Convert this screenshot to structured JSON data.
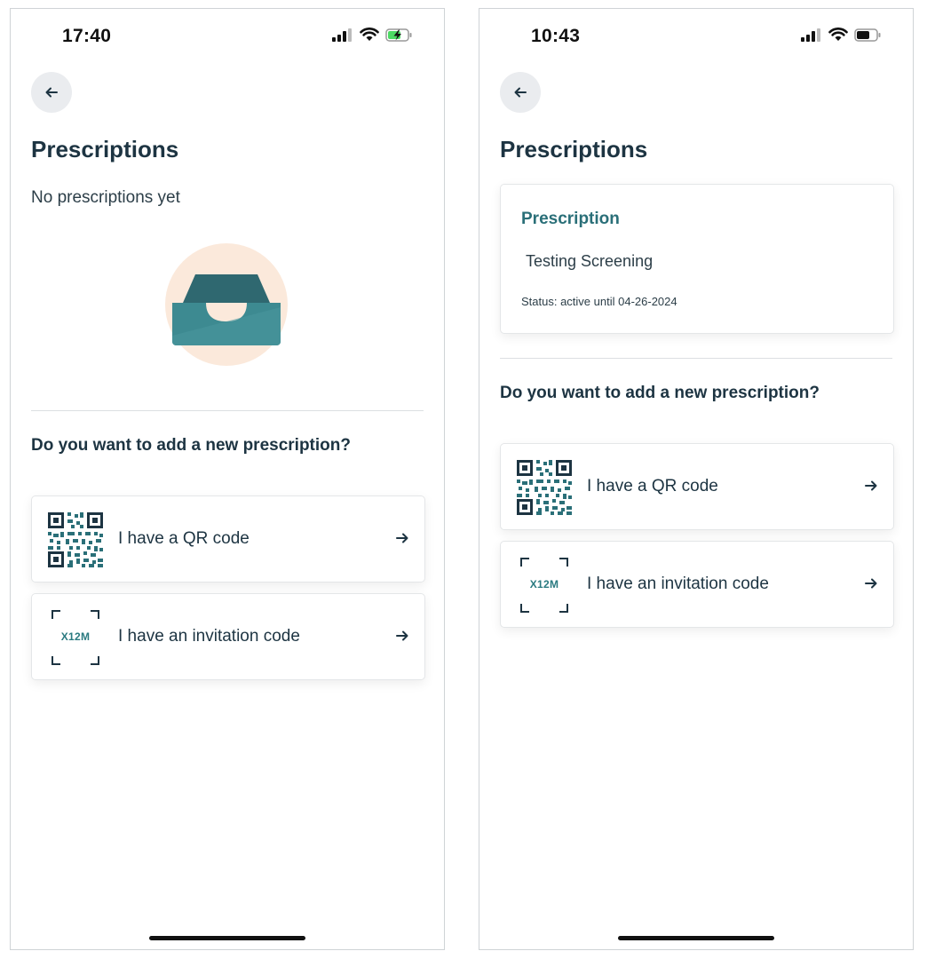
{
  "left_screen": {
    "status_bar": {
      "time": "17:40",
      "battery": "charging"
    },
    "title": "Prescriptions",
    "empty_text": "No prescriptions yet",
    "question": "Do you want to add a new prescription?",
    "options": [
      {
        "label": "I have a QR code",
        "icon": "qr-code-icon"
      },
      {
        "label": "I have an invitation code",
        "icon": "invitation-code-icon",
        "icon_text": "X12M"
      }
    ]
  },
  "right_screen": {
    "status_bar": {
      "time": "10:43",
      "battery": "partial"
    },
    "title": "Prescriptions",
    "prescription": {
      "heading": "Prescription",
      "name": "Testing Screening",
      "status": "Status: active until 04-26-2024"
    },
    "question": "Do you want to add a new prescription?",
    "options": [
      {
        "label": "I have a QR code",
        "icon": "qr-code-icon"
      },
      {
        "label": "I have an invitation code",
        "icon": "invitation-code-icon",
        "icon_text": "X12M"
      }
    ]
  },
  "colors": {
    "text_dark": "#1d3442",
    "accent_teal": "#2a6f78",
    "tray_teal": "#3d8a91",
    "tray_circle": "#fbe9db"
  }
}
